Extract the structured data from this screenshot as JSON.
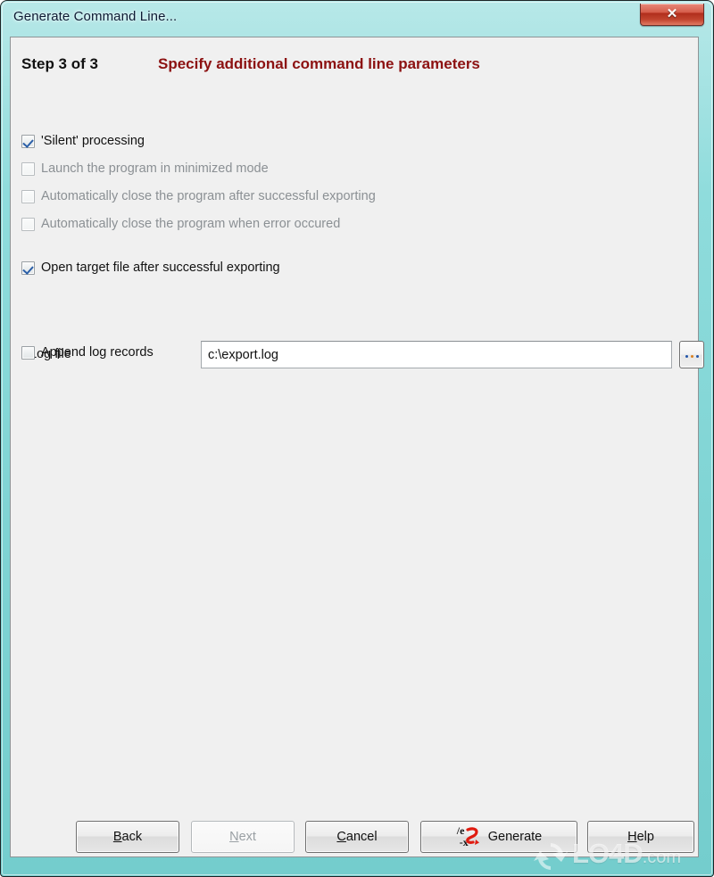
{
  "window": {
    "title": "Generate Command Line...",
    "close_glyph": "✕",
    "close_label": "Close"
  },
  "header": {
    "step": "Step 3 of 3",
    "title": "Specify additional command line parameters",
    "title_color": "#8c1111"
  },
  "options": [
    {
      "label": "'Silent' processing",
      "checked": true,
      "enabled": true
    },
    {
      "label": "Launch the program in minimized mode",
      "checked": false,
      "enabled": false
    },
    {
      "label": "Automatically close the program after successful exporting",
      "checked": false,
      "enabled": false
    },
    {
      "label": "Automatically close the program when error occured",
      "checked": false,
      "enabled": false
    },
    {
      "label": "Open target file after successful exporting",
      "checked": true,
      "enabled": true
    }
  ],
  "logfile": {
    "label": "Log file",
    "value": "c:\\export.log",
    "placeholder": "",
    "browse_label": "..."
  },
  "append": {
    "label": "Append log records",
    "checked": false,
    "enabled": true
  },
  "buttons": {
    "back": {
      "label": "Back",
      "accel": "B",
      "enabled": true
    },
    "next": {
      "label": "Next",
      "accel": "N",
      "enabled": false
    },
    "cancel": {
      "label": "Cancel",
      "accel": "C",
      "enabled": true
    },
    "generate": {
      "label": "Generate",
      "enabled": true,
      "icon_top": "/e",
      "icon_bottom": "-x"
    },
    "help": {
      "label": "Help",
      "accel": "H",
      "enabled": true
    }
  },
  "watermark": {
    "name": "LO4D",
    "suffix": ".com"
  }
}
